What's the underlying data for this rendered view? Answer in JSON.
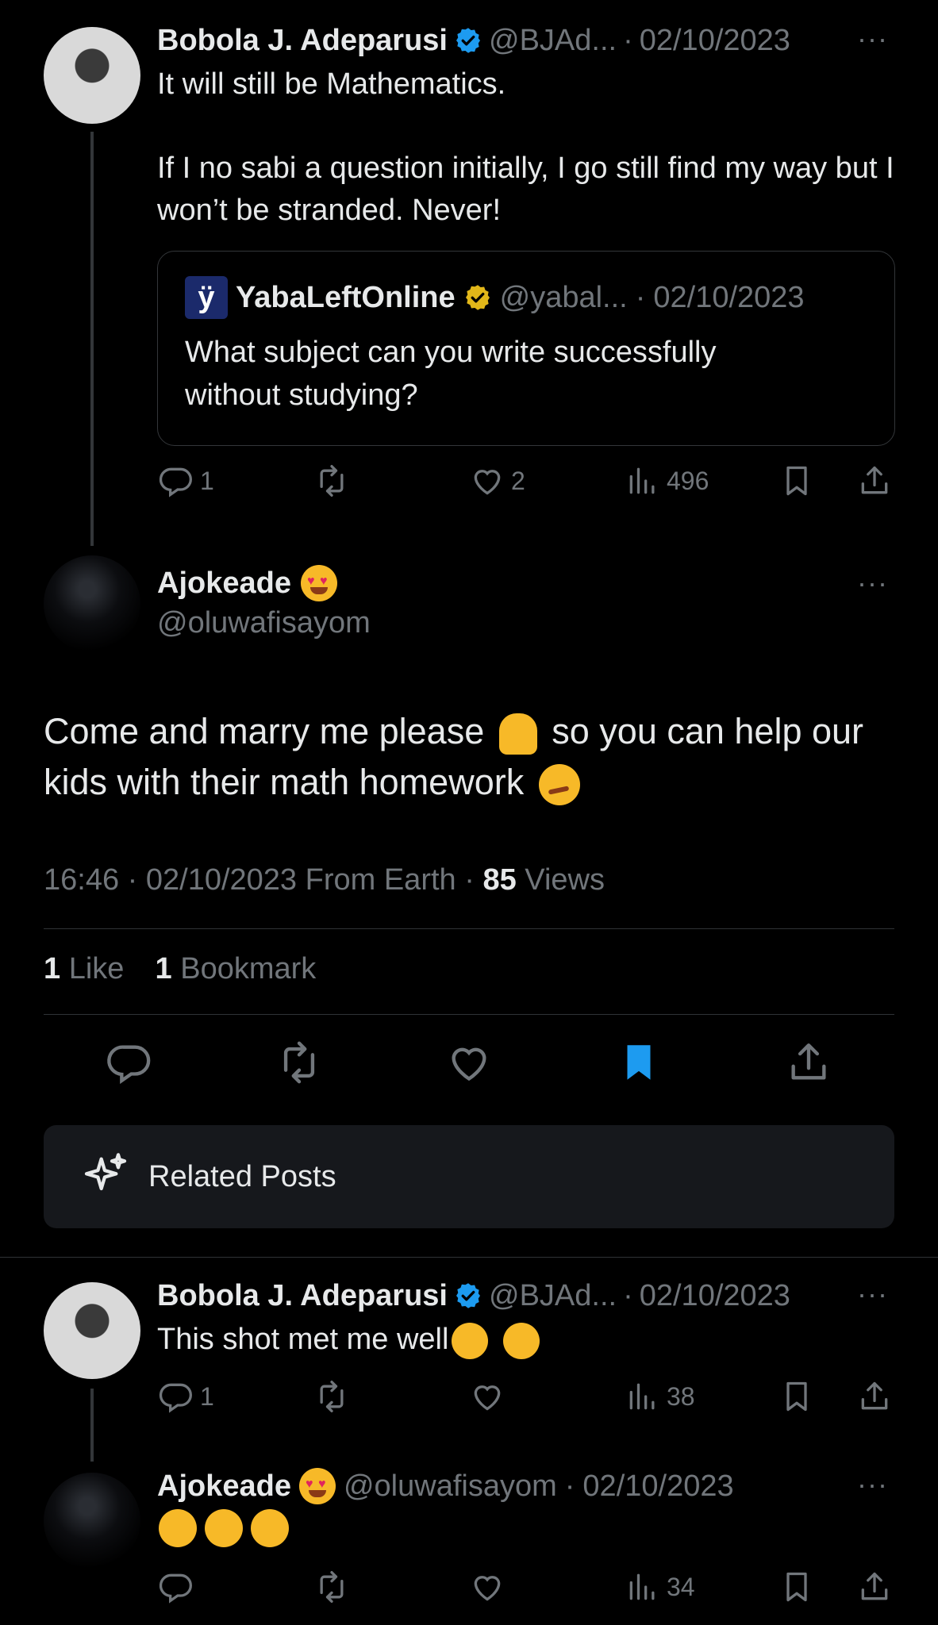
{
  "tweet1": {
    "name": "Bobola J. Adeparusi",
    "handle": "@BJAd...",
    "separator": "·",
    "date": "02/10/2023",
    "line1": "It will still be Mathematics.",
    "line2": "If I no sabi a question initially, I go still find my way but I won’t be stranded. Never!",
    "quote": {
      "logo_letter": "ÿ",
      "name": "YabaLeftOnline",
      "handle": "@yabal...",
      "separator": "·",
      "date": "02/10/2023",
      "text": "What subject can you write successfully without studying?"
    },
    "replies": "1",
    "likes": "2",
    "views": "496"
  },
  "main": {
    "name": "Ajokeade",
    "handle": "@oluwafisayom",
    "text_part1": "Come and marry me please",
    "text_part2": "so you can help our kids with their math homework",
    "time": "16:46",
    "sep1": "·",
    "date": "02/10/2023",
    "from": "From Earth",
    "sep2": "·",
    "views_count": "85",
    "views_label": "Views",
    "likes_count": "1",
    "likes_label": "Like",
    "bookmarks_count": "1",
    "bookmarks_label": "Bookmark",
    "related_label": "Related Posts"
  },
  "reply1": {
    "name": "Bobola J. Adeparusi",
    "handle": "@BJAd...",
    "separator": "·",
    "date": "02/10/2023",
    "text": "This shot met me well",
    "replies": "1",
    "views": "38"
  },
  "reply2": {
    "name": "Ajokeade",
    "handle": "@oluwafisayom",
    "separator": "·",
    "date": "02/10/2023",
    "views": "34"
  },
  "more_label": "···",
  "colors": {
    "background": "#000000",
    "text": "#e7e9ea",
    "secondary": "#71767b",
    "verified_blue": "#1d9bf0",
    "verified_gold": "#e2b719",
    "bookmark_active": "#1d9bf0"
  }
}
